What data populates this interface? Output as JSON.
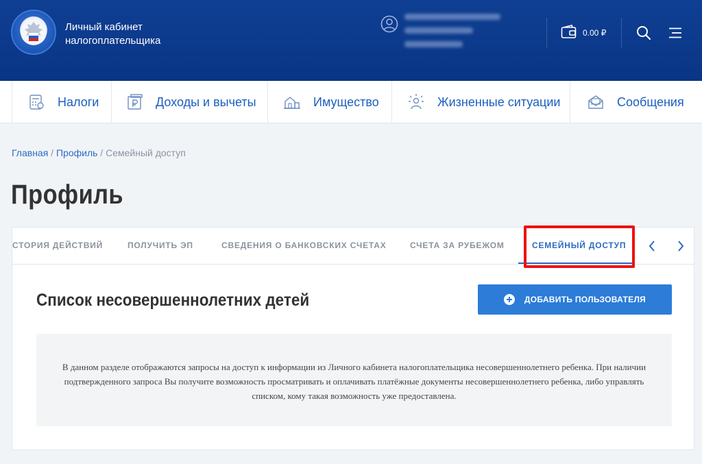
{
  "header": {
    "brand_line1": "Личный кабинет",
    "brand_line2": "налогоплательщика",
    "balance": "0.00 ₽",
    "colors": {
      "bg": "#0f3f93",
      "accent": "#2c7cd8"
    }
  },
  "nav": {
    "items": [
      {
        "label": "Налоги",
        "icon": "tax-calculator-icon"
      },
      {
        "label": "Доходы и вычеты",
        "icon": "ruble-document-icon"
      },
      {
        "label": "Имущество",
        "icon": "property-house-icon"
      },
      {
        "label": "Жизненные ситуации",
        "icon": "life-situations-icon"
      },
      {
        "label": "Сообщения",
        "icon": "messages-envelope-icon"
      }
    ]
  },
  "breadcrumb": {
    "home": "Главная",
    "sep1": " / ",
    "profile": "Профиль",
    "sep2": " / ",
    "current": "Семейный доступ"
  },
  "page": {
    "title": "Профиль"
  },
  "tabs": {
    "items": [
      {
        "label": "СТОРИЯ ДЕЙСТВИЙ"
      },
      {
        "label": "ПОЛУЧИТЬ ЭП"
      },
      {
        "label": "СВЕДЕНИЯ О БАНКОВСКИХ СЧЕТАХ"
      },
      {
        "label": "СЧЕТА ЗА РУБЕЖОМ"
      },
      {
        "label": "СЕМЕЙНЫЙ ДОСТУП",
        "active": true
      }
    ]
  },
  "section": {
    "title": "Список несовершеннолетних детей",
    "add_button": "ДОБАВИТЬ ПОЛЬЗОВАТЕЛЯ",
    "info_text": "В данном разделе отображаются запросы на доступ к информации из Личного кабинета налогоплательщика несовершеннолетнего ребенка. При наличии подтвержденного запроса Вы получите возможность просматривать и оплачивать платёжные документы несовершеннолетнего ребенка, либо управлять списком, кому такая возможность уже предоставлена."
  }
}
